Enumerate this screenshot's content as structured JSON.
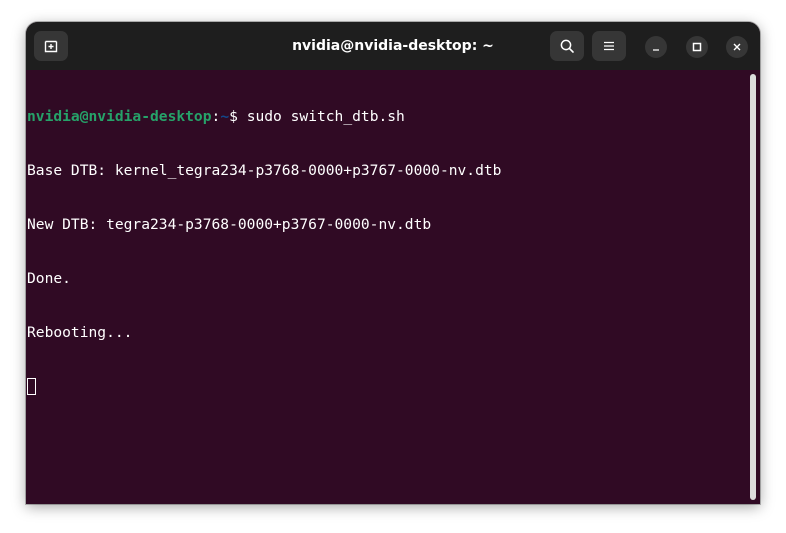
{
  "window": {
    "title": "nvidia@nvidia-desktop: ~"
  },
  "toolbar": {
    "new_tab_icon": "new-tab-icon",
    "search_icon": "search-icon",
    "menu_icon": "hamburger-menu-icon",
    "minimize_icon": "minimize-icon",
    "maximize_icon": "maximize-icon",
    "close_icon": "close-icon"
  },
  "terminal": {
    "prompt_user": "nvidia@nvidia-desktop",
    "prompt_sep": ":",
    "prompt_path": "~",
    "prompt_symbol": "$ ",
    "command": "sudo switch_dtb.sh",
    "output": [
      "Base DTB: kernel_tegra234-p3768-0000+p3767-0000-nv.dtb",
      "New DTB: tegra234-p3768-0000+p3767-0000-nv.dtb",
      "Done.",
      "Rebooting..."
    ]
  },
  "colors": {
    "terminal_bg": "#300a24",
    "titlebar_bg": "#1e1e1e",
    "prompt_user": "#26a269",
    "prompt_path": "#12488b",
    "text": "#ffffff"
  }
}
